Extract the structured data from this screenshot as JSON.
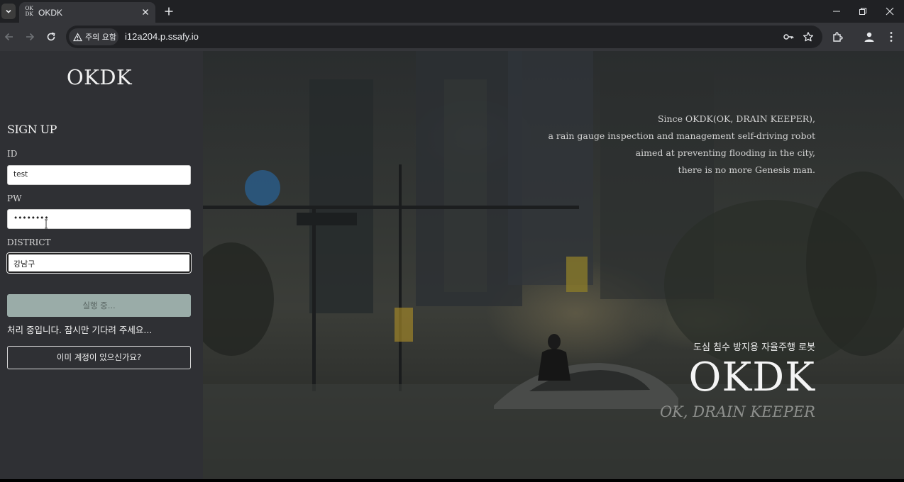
{
  "browser": {
    "favicon_text": "OK\nDK",
    "tab_title": "OKDK",
    "security_chip": "주의 요함",
    "url": "i12a204.p.ssafy.io"
  },
  "sidebar": {
    "logo": "OKDK",
    "heading": "SIGN UP",
    "id_label": "ID",
    "id_value": "test",
    "pw_label": "PW",
    "pw_value": "••••••••",
    "district_label": "DISTRICT",
    "district_value": "강남구",
    "submit_label": "실행 중...",
    "status_text": "처리 중입니다. 잠시만 기다려 주세요...",
    "login_link": "이미 계정이 있으신가요?"
  },
  "hero": {
    "description": [
      "Since OKDK(OK, DRAIN KEEPER),",
      "a rain gauge inspection and management self-driving robot",
      "aimed at preventing flooding in the city,",
      "there is no more Genesis man."
    ],
    "subtitle": "도심 침수 방지용 자율주행 로봇",
    "title": "OKDK",
    "tagline": "OK, DRAIN KEEPER"
  },
  "colors": {
    "sidebar_bg": "#2f3034",
    "submit_disabled": "#9aaca8",
    "chrome_dark": "#202124",
    "chrome_toolbar": "#35363a"
  }
}
